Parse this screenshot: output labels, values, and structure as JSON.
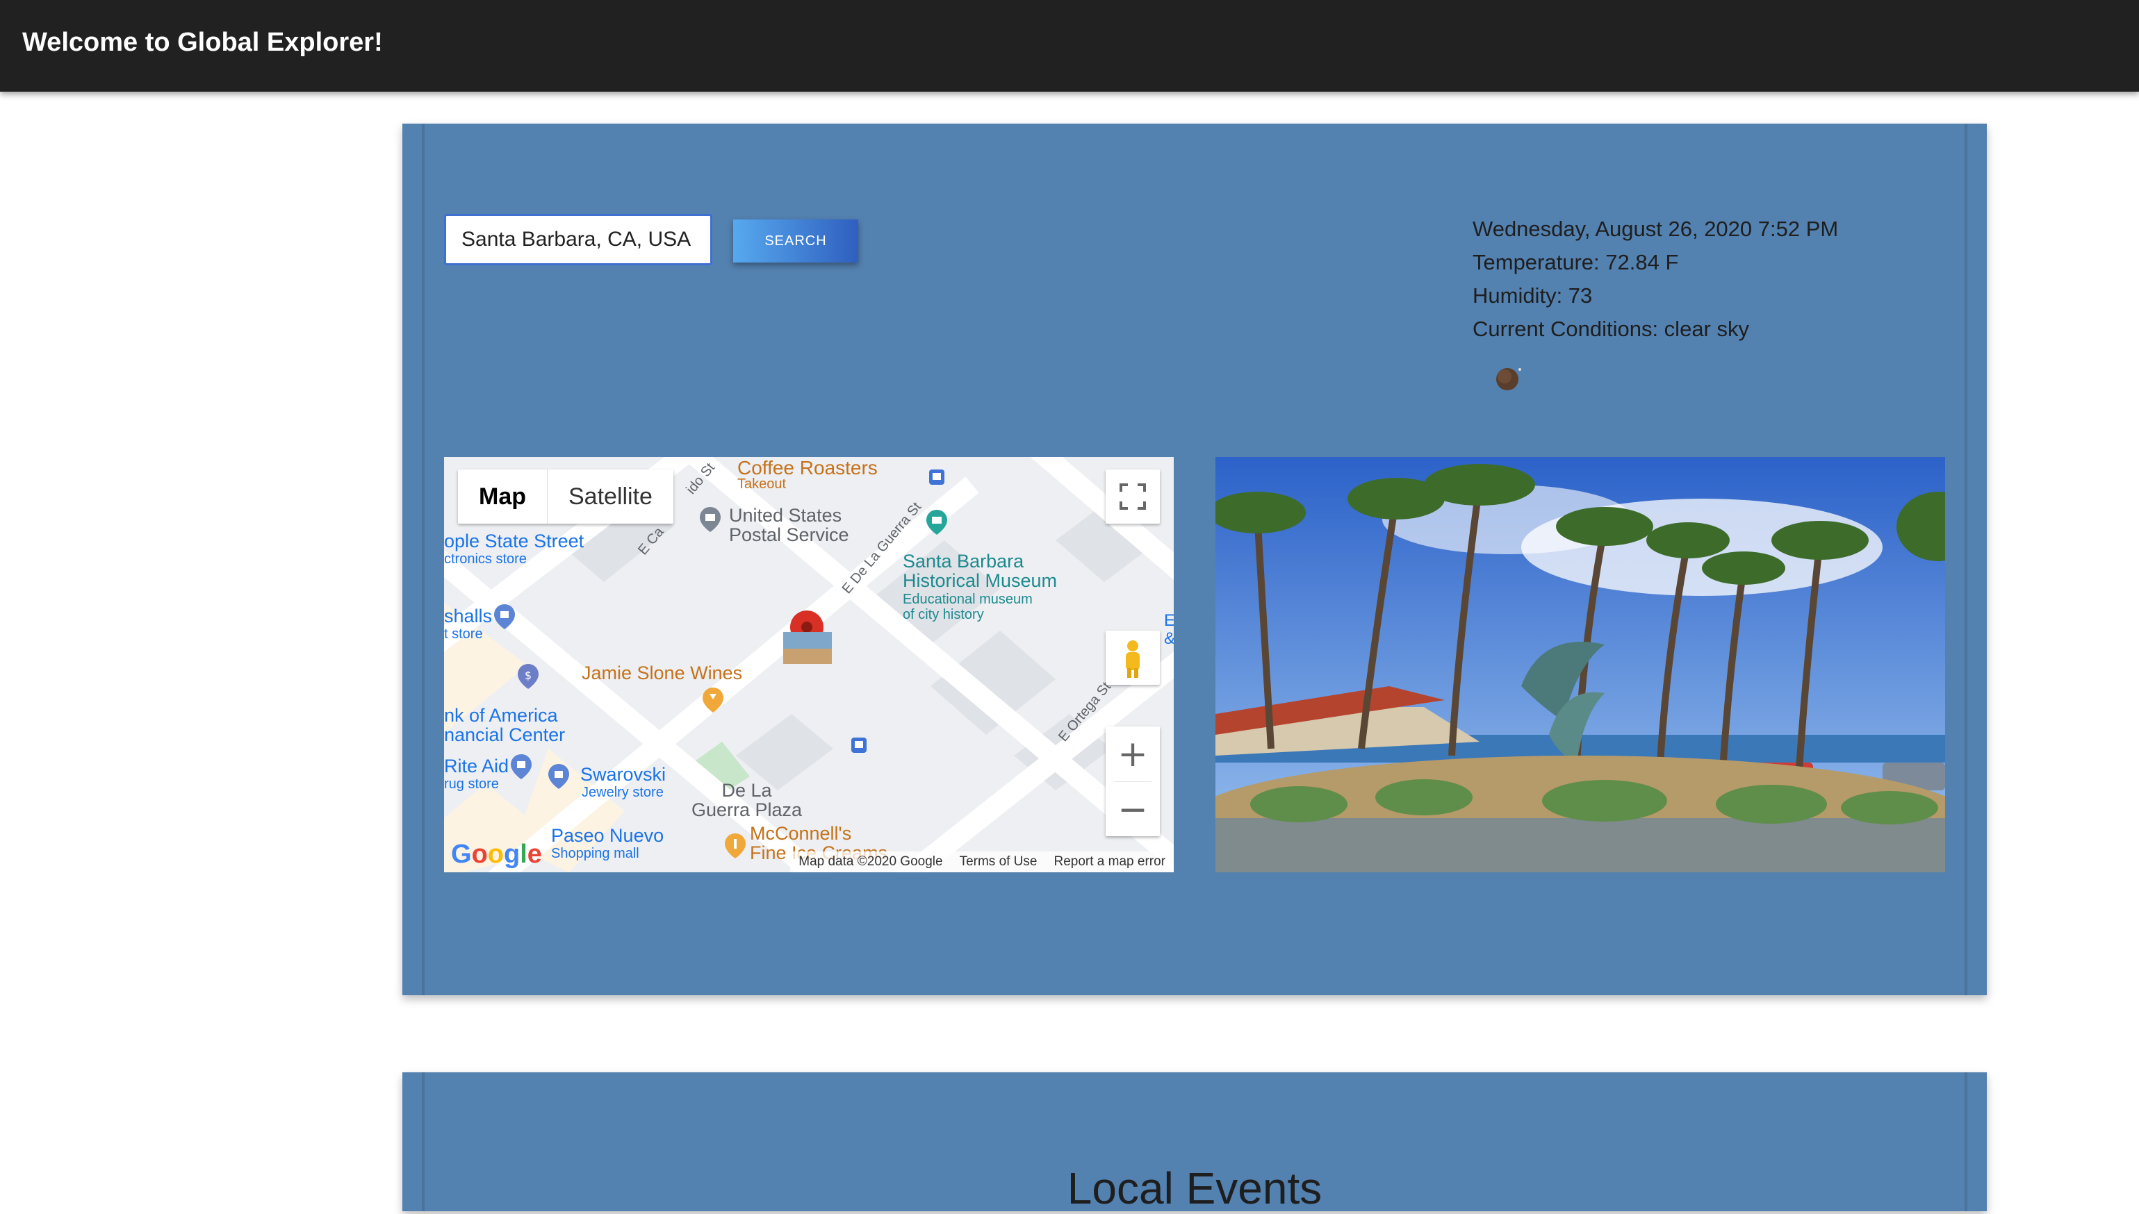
{
  "header": {
    "title": "Welcome to Global Explorer!"
  },
  "search": {
    "value": "Santa Barbara, CA, USA",
    "button_label": "SEARCH"
  },
  "weather": {
    "datetime": "Wednesday, August 26, 2020 7:52 PM",
    "temperature": "Temperature: 72.84 F",
    "humidity": "Humidity: 73",
    "conditions": "Current Conditions: clear sky",
    "icon": "clear-night-icon"
  },
  "map": {
    "type_map": "Map",
    "type_satellite": "Satellite",
    "labels": {
      "coffee": "Coffee Roasters",
      "coffee_sub": "Takeout",
      "post1": "United States",
      "post2": "Postal Service",
      "state_street": "ople State Street",
      "electronics": "ctronics store",
      "museum1": "Santa Barbara",
      "museum2": "Historical Museum",
      "museum3": "Educational museum",
      "museum4": "of city history",
      "marshalls": "shalls",
      "marshalls_sub": "t store",
      "jamie": "Jamie Slone Wines",
      "bank1": "nk of America",
      "bank2": "nancial Center",
      "riteaid": "Rite Aid",
      "riteaid_sub": "rug store",
      "swarovski": "Swarovski",
      "swarovski_sub": "Jewelry store",
      "plaza1": "De La",
      "plaza2": "Guerra Plaza",
      "paseo": "Paseo Nuevo",
      "paseo_sub": "Shopping mall",
      "mcconnells1": "McConnell's",
      "mcconnells2": "Fine Ice Creams",
      "street_guerra": "E De La Guerra St",
      "street_ortega": "E Ortega St",
      "street_ca": "E Ca",
      "street_cano": "ido St",
      "street_e": "E",
      "street_amp": "&"
    },
    "attribution": {
      "data": "Map data ©2020 Google",
      "terms": "Terms of Use",
      "report": "Report a map error"
    },
    "logo": "Google"
  },
  "events": {
    "title": "Local Events"
  }
}
